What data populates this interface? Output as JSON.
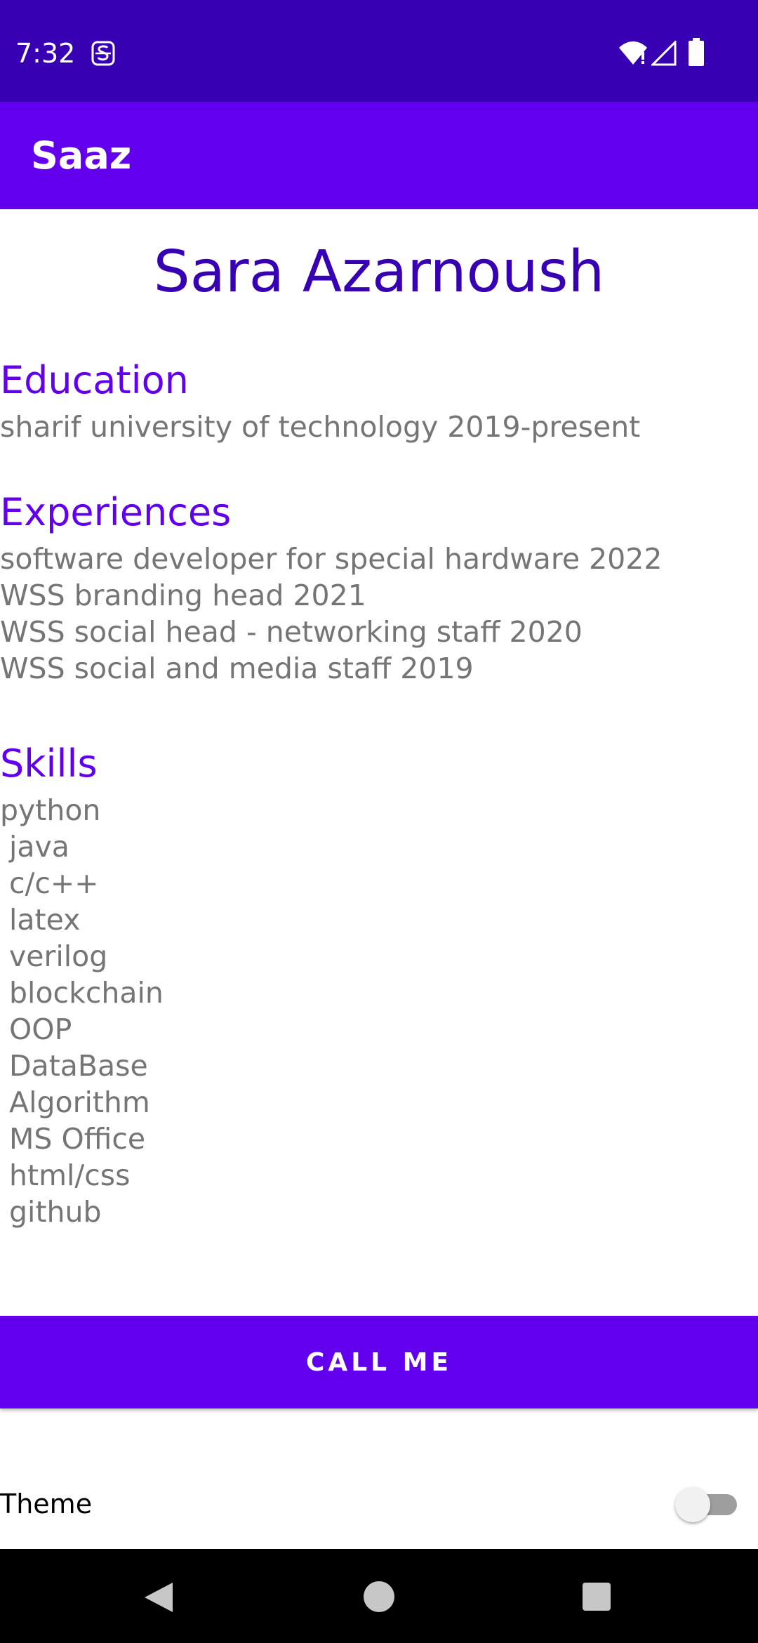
{
  "status_bar": {
    "time": "7:32",
    "icons": [
      "notification-s-icon",
      "wifi-icon",
      "signal-icon",
      "battery-icon"
    ]
  },
  "app_bar": {
    "title": "Saaz"
  },
  "profile": {
    "name": "Sara Azarnoush"
  },
  "education": {
    "heading": "Education",
    "text": "sharif university of technology 2019-present"
  },
  "experiences": {
    "heading": "Experiences",
    "text": "software developer for special hardware 2022\nWSS branding head 2021\nWSS social head - networking staff 2020\nWSS social and media staff 2019"
  },
  "skills": {
    "heading": "Skills",
    "text": "python\n java\n c/c++\n latex\n verilog\n blockchain\n OOP\n DataBase\n Algorithm\n MS Office\n html/css\n github"
  },
  "call_button": {
    "label": "CALL ME"
  },
  "theme": {
    "label": "Theme",
    "switch_on": false
  },
  "colors": {
    "status_bar": "#3700B3",
    "app_bar": "#6200EE",
    "heading": "#6200EE",
    "name": "#3700B3",
    "body_text": "#757575"
  },
  "nav_bar": {
    "icons": [
      "back-icon",
      "home-icon",
      "recents-icon"
    ]
  }
}
